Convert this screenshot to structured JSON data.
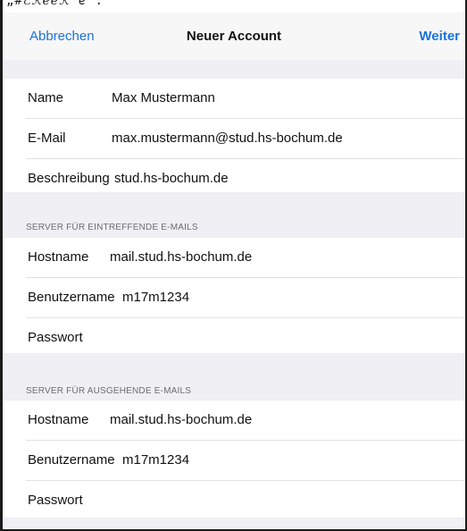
{
  "top_strip_text": "„#ℰℛℯℯℛ ɐ .",
  "navbar": {
    "cancel_label": "Abbrechen",
    "title": "Neuer Account",
    "next_label": "Weiter"
  },
  "account": {
    "name_label": "Name",
    "name_value": "Max Mustermann",
    "email_label": "E-Mail",
    "email_value": "max.mustermann@stud.hs-bochum.de",
    "description_label": "Beschreibung",
    "description_value": "stud.hs-bochum.de"
  },
  "incoming": {
    "header": "SERVER FÜR EINTREFFENDE E-MAILS",
    "hostname_label": "Hostname",
    "hostname_value": "mail.stud.hs-bochum.de",
    "username_label": "Benutzername",
    "username_value": "m17m1234",
    "password_label": "Passwort",
    "password_value": ""
  },
  "outgoing": {
    "header": "SERVER FÜR AUSGEHENDE E-MAILS",
    "hostname_label": "Hostname",
    "hostname_value": "mail.stud.hs-bochum.de",
    "username_label": "Benutzername",
    "username_value": "m17m1234",
    "password_label": "Passwort",
    "password_value": ""
  },
  "colors": {
    "accent": "#1a73d9",
    "group_background": "#efeff4"
  }
}
